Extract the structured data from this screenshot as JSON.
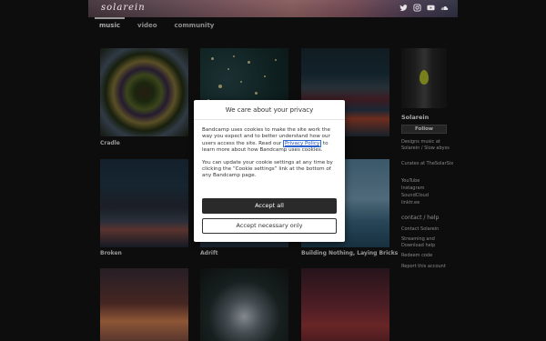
{
  "banner": {
    "logo": "solarein",
    "social_icons": [
      "twitter-icon",
      "instagram-icon",
      "youtube-icon",
      "soundcloud-icon"
    ]
  },
  "nav": {
    "items": [
      {
        "label": "music",
        "active": true
      },
      {
        "label": "video",
        "active": false
      },
      {
        "label": "community",
        "active": false
      }
    ]
  },
  "releases": [
    {
      "title": "Cradle"
    },
    {
      "title": ""
    },
    {
      "title": ""
    },
    {
      "title": "Broken"
    },
    {
      "title": "Adrift"
    },
    {
      "title": "Building Nothing, Laying Bricks"
    },
    {
      "title": ""
    },
    {
      "title": ""
    },
    {
      "title": ""
    }
  ],
  "artist": {
    "name": "Solarein",
    "follow_label": "Follow",
    "bio": "Designs music at Solarein / Slow abyss",
    "curates": "Curates at TheSolarSix",
    "links": [
      "YouTube",
      "Instagram",
      "SoundCloud",
      "linktr.ee"
    ],
    "contact_heading": "contact / help",
    "contact_links": [
      "Contact Solarein",
      "Streaming and Download help",
      "Redeem code",
      "Report this account"
    ]
  },
  "cookie_modal": {
    "title": "We care about your privacy",
    "body_part1": "Bandcamp uses cookies to make the site work the way you expect and to better understand how our users access the site. Read our ",
    "privacy_link": "Privacy Policy",
    "body_part2": " to learn more about how Bandcamp uses cookies.",
    "body_para2": "You can update your cookie settings at any time by clicking the “Cookie settings” link at the bottom of any Bandcamp page.",
    "accept_all": "Accept all",
    "accept_necessary": "Accept necessary only"
  }
}
